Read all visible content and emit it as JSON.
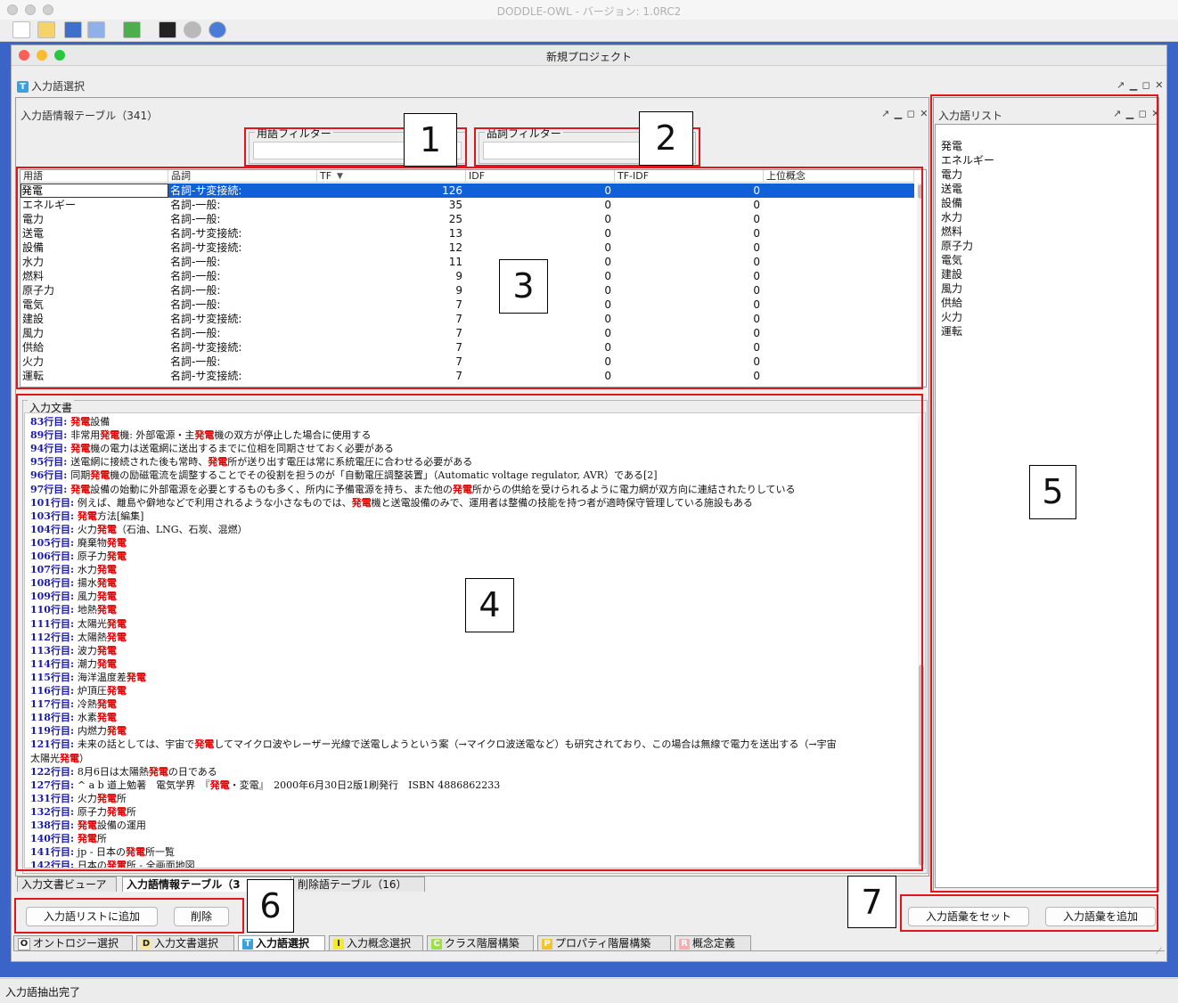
{
  "app": {
    "window_title": "DODDLE-OWL - バージョン: 1.0RC2"
  },
  "project": {
    "window_title": "新規プロジェクト"
  },
  "section": {
    "label": "入力語選択",
    "icon_letter": "T"
  },
  "info_panel": {
    "title": "入力語情報テーブル（341）"
  },
  "filters": {
    "term_label": "用語フィルター",
    "term_value": "",
    "pos_label": "品詞フィルター",
    "pos_value": ""
  },
  "table": {
    "headers": [
      "用語",
      "品詞",
      "TF",
      "IDF",
      "TF-IDF",
      "上位概念"
    ],
    "sort_indicator": "▼",
    "rows": [
      [
        "発電",
        "名詞-サ変接続:",
        "126",
        "0",
        "0",
        ""
      ],
      [
        "エネルギー",
        "名詞-一般:",
        "35",
        "0",
        "0",
        ""
      ],
      [
        "電力",
        "名詞-一般:",
        "25",
        "0",
        "0",
        ""
      ],
      [
        "送電",
        "名詞-サ変接続:",
        "13",
        "0",
        "0",
        ""
      ],
      [
        "設備",
        "名詞-サ変接続:",
        "12",
        "0",
        "0",
        ""
      ],
      [
        "水力",
        "名詞-一般:",
        "11",
        "0",
        "0",
        ""
      ],
      [
        "燃料",
        "名詞-一般:",
        "9",
        "0",
        "0",
        ""
      ],
      [
        "原子力",
        "名詞-一般:",
        "9",
        "0",
        "0",
        ""
      ],
      [
        "電気",
        "名詞-一般:",
        "7",
        "0",
        "0",
        ""
      ],
      [
        "建設",
        "名詞-サ変接続:",
        "7",
        "0",
        "0",
        ""
      ],
      [
        "風力",
        "名詞-一般:",
        "7",
        "0",
        "0",
        ""
      ],
      [
        "供給",
        "名詞-サ変接続:",
        "7",
        "0",
        "0",
        ""
      ],
      [
        "火力",
        "名詞-一般:",
        "7",
        "0",
        "0",
        ""
      ],
      [
        "運転",
        "名詞-サ変接続:",
        "7",
        "0",
        "0",
        ""
      ]
    ]
  },
  "doc": {
    "title": "入力文書",
    "lines": [
      [
        [
          "83行目: ",
          "ln"
        ],
        [
          "発電",
          "hl"
        ],
        [
          "設備",
          ""
        ]
      ],
      [
        [
          "89行目: ",
          "ln"
        ],
        [
          "非常用",
          ""
        ],
        [
          "発電",
          "hl"
        ],
        [
          "機: 外部電源・主",
          ""
        ],
        [
          "発電",
          "hl"
        ],
        [
          "機の双方が停止した場合に使用する",
          ""
        ]
      ],
      [
        [
          "94行目: ",
          "ln"
        ],
        [
          "発電",
          "hl"
        ],
        [
          "機の電力は送電網に送出するまでに位相を同期させておく必要がある",
          ""
        ]
      ],
      [
        [
          "95行目: ",
          "ln"
        ],
        [
          "送電網に接続された後も常時、",
          ""
        ],
        [
          "発電",
          "hl"
        ],
        [
          "所が送り出す電圧は常に系統電圧に合わせる必要がある",
          ""
        ]
      ],
      [
        [
          "96行目: ",
          "ln"
        ],
        [
          "同期",
          ""
        ],
        [
          "発電",
          "hl"
        ],
        [
          "機の励磁電流を調整することでその役割を担うのが「自動電圧調整装置」（Automatic voltage regulator, AVR）である[2]",
          ""
        ]
      ],
      [
        [
          "97行目: ",
          "ln"
        ],
        [
          "発電",
          "hl"
        ],
        [
          "設備の始動に外部電源を必要とするものも多く、所内に予備電源を持ち、また他の",
          ""
        ],
        [
          "発電",
          "hl"
        ],
        [
          "所からの供給を受けられるように電力網が双方向に連結されたりしている",
          ""
        ]
      ],
      [
        [
          "101行目: ",
          "ln"
        ],
        [
          "例えば、離島や僻地などで利用されるような小さなものでは、",
          ""
        ],
        [
          "発電",
          "hl"
        ],
        [
          "機と送電設備のみで、運用者は整備の技能を持つ者が適時保守管理している施設もある",
          ""
        ]
      ],
      [
        [
          "103行目: ",
          "ln"
        ],
        [
          "発電",
          "hl"
        ],
        [
          "方法[編集]",
          ""
        ]
      ],
      [
        [
          "104行目: ",
          "ln"
        ],
        [
          "火力",
          ""
        ],
        [
          "発電",
          "hl"
        ],
        [
          "（石油、LNG、石炭、混燃）",
          ""
        ]
      ],
      [
        [
          "105行目: ",
          "ln"
        ],
        [
          "廃棄物",
          ""
        ],
        [
          "発電",
          "hl"
        ]
      ],
      [
        [
          "106行目: ",
          "ln"
        ],
        [
          "原子力",
          ""
        ],
        [
          "発電",
          "hl"
        ]
      ],
      [
        [
          "107行目: ",
          "ln"
        ],
        [
          "水力",
          ""
        ],
        [
          "発電",
          "hl"
        ]
      ],
      [
        [
          "108行目: ",
          "ln"
        ],
        [
          "揚水",
          ""
        ],
        [
          "発電",
          "hl"
        ]
      ],
      [
        [
          "109行目: ",
          "ln"
        ],
        [
          "風力",
          ""
        ],
        [
          "発電",
          "hl"
        ]
      ],
      [
        [
          "110行目: ",
          "ln"
        ],
        [
          "地熱",
          ""
        ],
        [
          "発電",
          "hl"
        ]
      ],
      [
        [
          "111行目: ",
          "ln"
        ],
        [
          "太陽光",
          ""
        ],
        [
          "発電",
          "hl"
        ]
      ],
      [
        [
          "112行目: ",
          "ln"
        ],
        [
          "太陽熱",
          ""
        ],
        [
          "発電",
          "hl"
        ]
      ],
      [
        [
          "113行目: ",
          "ln"
        ],
        [
          "波力",
          ""
        ],
        [
          "発電",
          "hl"
        ]
      ],
      [
        [
          "114行目: ",
          "ln"
        ],
        [
          "潮力",
          ""
        ],
        [
          "発電",
          "hl"
        ]
      ],
      [
        [
          "115行目: ",
          "ln"
        ],
        [
          "海洋温度差",
          ""
        ],
        [
          "発電",
          "hl"
        ]
      ],
      [
        [
          "116行目: ",
          "ln"
        ],
        [
          "炉頂圧",
          ""
        ],
        [
          "発電",
          "hl"
        ]
      ],
      [
        [
          "117行目: ",
          "ln"
        ],
        [
          "冷熱",
          ""
        ],
        [
          "発電",
          "hl"
        ]
      ],
      [
        [
          "118行目: ",
          "ln"
        ],
        [
          "水素",
          ""
        ],
        [
          "発電",
          "hl"
        ]
      ],
      [
        [
          "119行目: ",
          "ln"
        ],
        [
          "内燃力",
          ""
        ],
        [
          "発電",
          "hl"
        ]
      ],
      [
        [
          "121行目: ",
          "ln"
        ],
        [
          "未来の話としては、宇宙で",
          ""
        ],
        [
          "発電",
          "hl"
        ],
        [
          "してマイクロ波やレーザー光線で送電しようという案（→マイクロ波送電など）も研究されており、この場合は無線で電力を送出する（→宇宙",
          ""
        ]
      ],
      [
        [
          "太陽光",
          ""
        ],
        [
          "発電",
          "hl"
        ],
        [
          "）",
          ""
        ]
      ],
      [
        [
          "122行目: ",
          "ln"
        ],
        [
          "8月6日は太陽熱",
          ""
        ],
        [
          "発電",
          "hl"
        ],
        [
          "の日である",
          ""
        ]
      ],
      [
        [
          "127行目: ",
          "ln"
        ],
        [
          "^ a b 道上勉著　電気学界　『",
          ""
        ],
        [
          "発電",
          "hl"
        ],
        [
          "・変電』　2000年6月30日2版1刷発行　ISBN 4886862233",
          ""
        ]
      ],
      [
        [
          "131行目: ",
          "ln"
        ],
        [
          "火力",
          ""
        ],
        [
          "発電",
          "hl"
        ],
        [
          "所",
          ""
        ]
      ],
      [
        [
          "132行目: ",
          "ln"
        ],
        [
          "原子力",
          ""
        ],
        [
          "発電",
          "hl"
        ],
        [
          "所",
          ""
        ]
      ],
      [
        [
          "138行目: ",
          "ln"
        ],
        [
          "発電",
          "hl"
        ],
        [
          "設備の運用",
          ""
        ]
      ],
      [
        [
          "140行目: ",
          "ln"
        ],
        [
          "発電",
          "hl"
        ],
        [
          "所",
          ""
        ]
      ],
      [
        [
          "141行目: ",
          "ln"
        ],
        [
          "jp - 日本の",
          ""
        ],
        [
          "発電",
          "hl"
        ],
        [
          "所一覧",
          ""
        ]
      ],
      [
        [
          "142行目: ",
          "ln"
        ],
        [
          "日本の",
          ""
        ],
        [
          "発電",
          "hl"
        ],
        [
          "所 - 全画面地図",
          ""
        ]
      ]
    ]
  },
  "wordlist": {
    "title": "入力語リスト",
    "items": [
      "発電",
      "エネルギー",
      "電力",
      "送電",
      "設備",
      "水力",
      "燃料",
      "原子力",
      "電気",
      "建設",
      "風力",
      "供給",
      "火力",
      "運転"
    ]
  },
  "subtabs": [
    "入力文書ビューア",
    "入力語情報テーブル（3",
    "削除語テーブル（16）"
  ],
  "buttons": {
    "add_to_list": "入力語リストに追加",
    "delete": "削除",
    "set_vocab": "入力語彙をセット",
    "add_vocab": "入力語彙を追加"
  },
  "bottom_tabs": [
    {
      "letter": "O",
      "label": "オントロジー選択",
      "color": "#ffffff"
    },
    {
      "letter": "D",
      "label": "入力文書選択",
      "color": "#f7e7a0"
    },
    {
      "letter": "T",
      "label": "入力語選択",
      "color": "#3aa0e0"
    },
    {
      "letter": "I",
      "label": "入力概念選択",
      "color": "#f2ea2a"
    },
    {
      "letter": "C",
      "label": "クラス階層構築",
      "color": "#9ee04a"
    },
    {
      "letter": "P",
      "label": "プロパティ階層構築",
      "color": "#f4c430"
    },
    {
      "letter": "R",
      "label": "概念定義",
      "color": "#f2b0b0"
    }
  ],
  "callouts": [
    "1",
    "2",
    "3",
    "4",
    "5",
    "6",
    "7"
  ],
  "status": {
    "text": "入力語抽出完了"
  },
  "colors": {
    "highlight": "#e00000",
    "line_number": "#1a1ab0",
    "selection": "#1060d8",
    "callout_border": "#e0161b",
    "desktop": "#3a64c8"
  }
}
